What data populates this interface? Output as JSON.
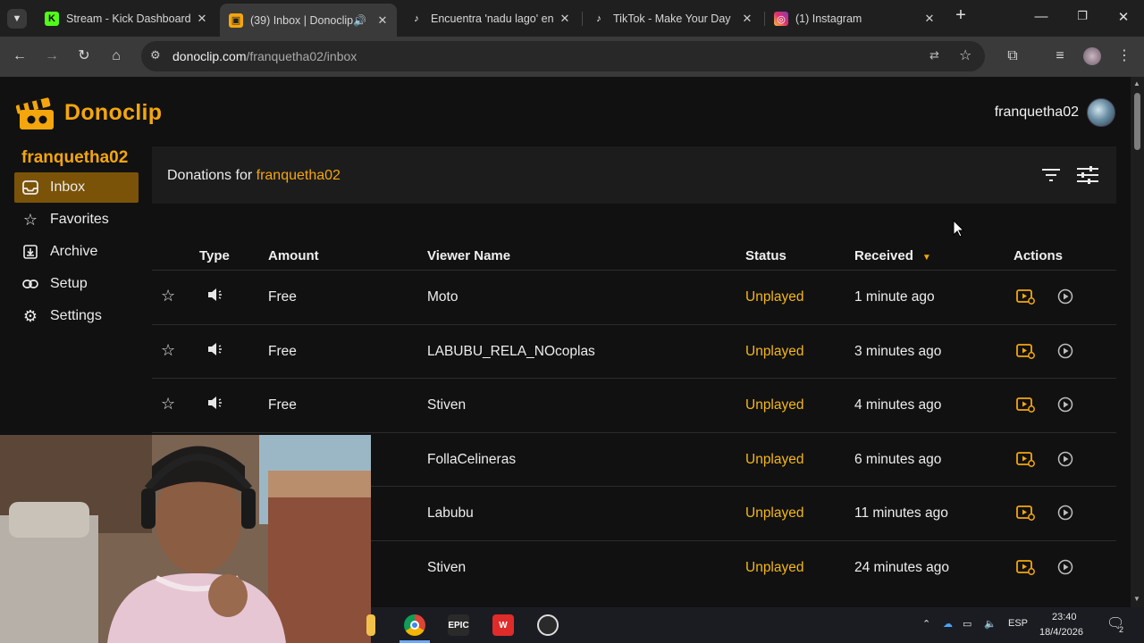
{
  "browser": {
    "tabs": [
      {
        "title": "Stream - Kick Dashboard",
        "favicon": "kick-icon"
      },
      {
        "title": "(39) Inbox | Donoclip",
        "favicon": "donoclip-icon",
        "active": true,
        "audio": true
      },
      {
        "title": "Encuentra 'nadu lago' en",
        "favicon": "tiktok-icon"
      },
      {
        "title": "TikTok - Make Your Day",
        "favicon": "tiktok-icon"
      },
      {
        "title": "(1) Instagram",
        "favicon": "instagram-icon"
      }
    ],
    "url_host": "donoclip.com",
    "url_path": "/franquetha02/inbox"
  },
  "app": {
    "brand": "Donoclip",
    "header_user": "franquetha02",
    "sidebar_user": "franquetha02",
    "nav": [
      {
        "label": "Inbox",
        "icon": "inbox-icon",
        "active": true
      },
      {
        "label": "Favorites",
        "icon": "star-icon"
      },
      {
        "label": "Archive",
        "icon": "archive-icon"
      },
      {
        "label": "Setup",
        "icon": "link-icon"
      },
      {
        "label": "Settings",
        "icon": "gear-icon"
      }
    ],
    "panel_title_prefix": "Donations for",
    "panel_title_user": "franquetha02",
    "accent": "#f4a60c"
  },
  "table": {
    "headers": {
      "type": "Type",
      "amount": "Amount",
      "viewer": "Viewer Name",
      "status": "Status",
      "received": "Received",
      "actions": "Actions"
    },
    "rows": [
      {
        "amount": "Free",
        "viewer": "Moto",
        "status": "Unplayed",
        "received": "1 minute ago"
      },
      {
        "amount": "Free",
        "viewer": "LABUBU_RELA_NOcoplas",
        "status": "Unplayed",
        "received": "3 minutes ago"
      },
      {
        "amount": "Free",
        "viewer": "Stiven",
        "status": "Unplayed",
        "received": "4 minutes ago"
      },
      {
        "amount": "",
        "viewer": "FollaCelineras",
        "status": "Unplayed",
        "received": "6 minutes ago"
      },
      {
        "amount": "",
        "viewer": "Labubu",
        "status": "Unplayed",
        "received": "11 minutes ago"
      },
      {
        "amount": "",
        "viewer": "Stiven",
        "status": "Unplayed",
        "received": "24 minutes ago"
      }
    ]
  },
  "taskbar": {
    "apps": [
      {
        "icon": "chrome-icon"
      },
      {
        "icon": "epic-games-icon",
        "label": "EPIC"
      },
      {
        "icon": "wps-icon",
        "label": "W"
      },
      {
        "icon": "obs-icon"
      }
    ],
    "lang": "ESP",
    "time": "23:40",
    "date": "18/4/2026",
    "notifications": "2"
  }
}
